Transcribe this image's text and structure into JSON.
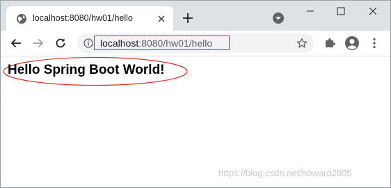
{
  "tab": {
    "title": "localhost:8080/hw01/hello",
    "favicon": "globe-icon",
    "close_icon": "close-icon"
  },
  "tabstrip": {
    "new_tab_icon": "plus-icon",
    "tab_search_icon": "chevron-down-circle-icon",
    "window_controls": [
      "minimize-icon",
      "maximize-icon",
      "close-icon"
    ]
  },
  "toolbar": {
    "back_icon": "arrow-left-icon",
    "forward_icon": "arrow-right-icon",
    "reload_icon": "reload-icon",
    "site_info_icon": "info-icon",
    "url_host": "localhost",
    "url_rest": ":8080/hw01/hello",
    "bookmark_icon": "star-icon",
    "extensions_icon": "puzzle-icon",
    "account_icon": "account-icon",
    "menu_icon": "kebab-menu-icon"
  },
  "page": {
    "heading": "Hello Spring Boot World!"
  },
  "watermark": "https://blog.csdn.net/howard2005",
  "colors": {
    "tabstrip_bg": "#dee1e6",
    "omnibox_bg": "#f1f3f4",
    "annotation_red": "#e0301e",
    "icon_gray": "#5f6368"
  }
}
